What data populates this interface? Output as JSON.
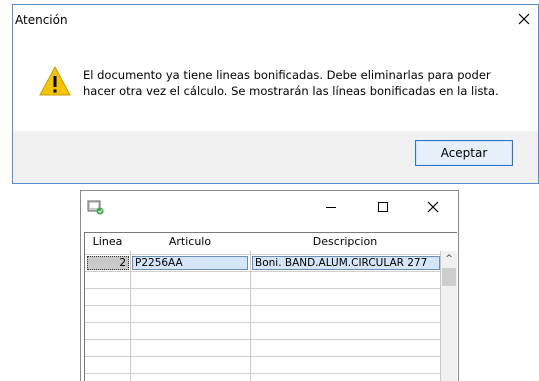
{
  "dialog": {
    "title": "Atención",
    "message_line1": "El documento ya tiene lineas bonificadas. Debe eliminarlas para poder",
    "message_line2": "hacer otra vez el cálculo. Se mostrarán las líneas bonificadas en la lista.",
    "accept_button": "Aceptar",
    "icons": {
      "close": "close-icon",
      "warning": "warning-icon"
    },
    "accent_color": "#2b76d4",
    "warning_color": "#f5c400"
  },
  "lines_window": {
    "icons": [
      "app-icon",
      "minimize-icon",
      "maximize-icon",
      "close-icon"
    ],
    "columns": [
      "Linea",
      "Articulo",
      "Descripcion"
    ],
    "rows": [
      {
        "linea": "2",
        "articulo": "P2256AA",
        "descripcion": "Boni. BAND.ALUM.CIRCULAR 277"
      }
    ],
    "scroll_up_glyph": "^",
    "selection_color": "#d4e6f7"
  }
}
